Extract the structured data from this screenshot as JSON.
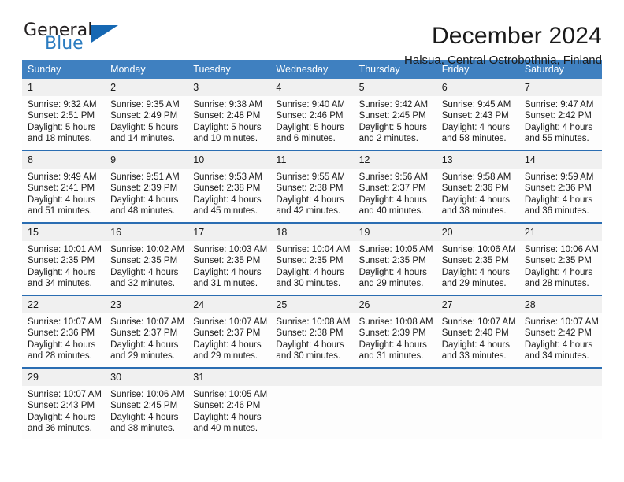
{
  "brand": {
    "name_part1": "General",
    "name_part2": "Blue",
    "triangle_color": "#1668b3",
    "blue_color": "#2b7cc0"
  },
  "header": {
    "title": "December 2024",
    "location": "Halsua, Central Ostrobothnia, Finland"
  },
  "theme": {
    "header_bg": "#3f80c0",
    "row_divider": "#2a6db2",
    "daynum_bg": "#f0f0f0",
    "cell_bg": "#fdfdfd",
    "text": "#1a1a1a"
  },
  "calendar": {
    "weekday_headers": [
      "Sunday",
      "Monday",
      "Tuesday",
      "Wednesday",
      "Thursday",
      "Friday",
      "Saturday"
    ],
    "labels": {
      "sunrise": "Sunrise:",
      "sunset": "Sunset:",
      "daylight": "Daylight:"
    },
    "weeks": [
      [
        {
          "day": "1",
          "sunrise": "Sunrise: 9:32 AM",
          "sunset": "Sunset: 2:51 PM",
          "daylight1": "Daylight: 5 hours",
          "daylight2": "and 18 minutes."
        },
        {
          "day": "2",
          "sunrise": "Sunrise: 9:35 AM",
          "sunset": "Sunset: 2:49 PM",
          "daylight1": "Daylight: 5 hours",
          "daylight2": "and 14 minutes."
        },
        {
          "day": "3",
          "sunrise": "Sunrise: 9:38 AM",
          "sunset": "Sunset: 2:48 PM",
          "daylight1": "Daylight: 5 hours",
          "daylight2": "and 10 minutes."
        },
        {
          "day": "4",
          "sunrise": "Sunrise: 9:40 AM",
          "sunset": "Sunset: 2:46 PM",
          "daylight1": "Daylight: 5 hours",
          "daylight2": "and 6 minutes."
        },
        {
          "day": "5",
          "sunrise": "Sunrise: 9:42 AM",
          "sunset": "Sunset: 2:45 PM",
          "daylight1": "Daylight: 5 hours",
          "daylight2": "and 2 minutes."
        },
        {
          "day": "6",
          "sunrise": "Sunrise: 9:45 AM",
          "sunset": "Sunset: 2:43 PM",
          "daylight1": "Daylight: 4 hours",
          "daylight2": "and 58 minutes."
        },
        {
          "day": "7",
          "sunrise": "Sunrise: 9:47 AM",
          "sunset": "Sunset: 2:42 PM",
          "daylight1": "Daylight: 4 hours",
          "daylight2": "and 55 minutes."
        }
      ],
      [
        {
          "day": "8",
          "sunrise": "Sunrise: 9:49 AM",
          "sunset": "Sunset: 2:41 PM",
          "daylight1": "Daylight: 4 hours",
          "daylight2": "and 51 minutes."
        },
        {
          "day": "9",
          "sunrise": "Sunrise: 9:51 AM",
          "sunset": "Sunset: 2:39 PM",
          "daylight1": "Daylight: 4 hours",
          "daylight2": "and 48 minutes."
        },
        {
          "day": "10",
          "sunrise": "Sunrise: 9:53 AM",
          "sunset": "Sunset: 2:38 PM",
          "daylight1": "Daylight: 4 hours",
          "daylight2": "and 45 minutes."
        },
        {
          "day": "11",
          "sunrise": "Sunrise: 9:55 AM",
          "sunset": "Sunset: 2:38 PM",
          "daylight1": "Daylight: 4 hours",
          "daylight2": "and 42 minutes."
        },
        {
          "day": "12",
          "sunrise": "Sunrise: 9:56 AM",
          "sunset": "Sunset: 2:37 PM",
          "daylight1": "Daylight: 4 hours",
          "daylight2": "and 40 minutes."
        },
        {
          "day": "13",
          "sunrise": "Sunrise: 9:58 AM",
          "sunset": "Sunset: 2:36 PM",
          "daylight1": "Daylight: 4 hours",
          "daylight2": "and 38 minutes."
        },
        {
          "day": "14",
          "sunrise": "Sunrise: 9:59 AM",
          "sunset": "Sunset: 2:36 PM",
          "daylight1": "Daylight: 4 hours",
          "daylight2": "and 36 minutes."
        }
      ],
      [
        {
          "day": "15",
          "sunrise": "Sunrise: 10:01 AM",
          "sunset": "Sunset: 2:35 PM",
          "daylight1": "Daylight: 4 hours",
          "daylight2": "and 34 minutes."
        },
        {
          "day": "16",
          "sunrise": "Sunrise: 10:02 AM",
          "sunset": "Sunset: 2:35 PM",
          "daylight1": "Daylight: 4 hours",
          "daylight2": "and 32 minutes."
        },
        {
          "day": "17",
          "sunrise": "Sunrise: 10:03 AM",
          "sunset": "Sunset: 2:35 PM",
          "daylight1": "Daylight: 4 hours",
          "daylight2": "and 31 minutes."
        },
        {
          "day": "18",
          "sunrise": "Sunrise: 10:04 AM",
          "sunset": "Sunset: 2:35 PM",
          "daylight1": "Daylight: 4 hours",
          "daylight2": "and 30 minutes."
        },
        {
          "day": "19",
          "sunrise": "Sunrise: 10:05 AM",
          "sunset": "Sunset: 2:35 PM",
          "daylight1": "Daylight: 4 hours",
          "daylight2": "and 29 minutes."
        },
        {
          "day": "20",
          "sunrise": "Sunrise: 10:06 AM",
          "sunset": "Sunset: 2:35 PM",
          "daylight1": "Daylight: 4 hours",
          "daylight2": "and 29 minutes."
        },
        {
          "day": "21",
          "sunrise": "Sunrise: 10:06 AM",
          "sunset": "Sunset: 2:35 PM",
          "daylight1": "Daylight: 4 hours",
          "daylight2": "and 28 minutes."
        }
      ],
      [
        {
          "day": "22",
          "sunrise": "Sunrise: 10:07 AM",
          "sunset": "Sunset: 2:36 PM",
          "daylight1": "Daylight: 4 hours",
          "daylight2": "and 28 minutes."
        },
        {
          "day": "23",
          "sunrise": "Sunrise: 10:07 AM",
          "sunset": "Sunset: 2:37 PM",
          "daylight1": "Daylight: 4 hours",
          "daylight2": "and 29 minutes."
        },
        {
          "day": "24",
          "sunrise": "Sunrise: 10:07 AM",
          "sunset": "Sunset: 2:37 PM",
          "daylight1": "Daylight: 4 hours",
          "daylight2": "and 29 minutes."
        },
        {
          "day": "25",
          "sunrise": "Sunrise: 10:08 AM",
          "sunset": "Sunset: 2:38 PM",
          "daylight1": "Daylight: 4 hours",
          "daylight2": "and 30 minutes."
        },
        {
          "day": "26",
          "sunrise": "Sunrise: 10:08 AM",
          "sunset": "Sunset: 2:39 PM",
          "daylight1": "Daylight: 4 hours",
          "daylight2": "and 31 minutes."
        },
        {
          "day": "27",
          "sunrise": "Sunrise: 10:07 AM",
          "sunset": "Sunset: 2:40 PM",
          "daylight1": "Daylight: 4 hours",
          "daylight2": "and 33 minutes."
        },
        {
          "day": "28",
          "sunrise": "Sunrise: 10:07 AM",
          "sunset": "Sunset: 2:42 PM",
          "daylight1": "Daylight: 4 hours",
          "daylight2": "and 34 minutes."
        }
      ],
      [
        {
          "day": "29",
          "sunrise": "Sunrise: 10:07 AM",
          "sunset": "Sunset: 2:43 PM",
          "daylight1": "Daylight: 4 hours",
          "daylight2": "and 36 minutes."
        },
        {
          "day": "30",
          "sunrise": "Sunrise: 10:06 AM",
          "sunset": "Sunset: 2:45 PM",
          "daylight1": "Daylight: 4 hours",
          "daylight2": "and 38 minutes."
        },
        {
          "day": "31",
          "sunrise": "Sunrise: 10:05 AM",
          "sunset": "Sunset: 2:46 PM",
          "daylight1": "Daylight: 4 hours",
          "daylight2": "and 40 minutes."
        },
        {
          "day": "",
          "sunrise": "",
          "sunset": "",
          "daylight1": "",
          "daylight2": ""
        },
        {
          "day": "",
          "sunrise": "",
          "sunset": "",
          "daylight1": "",
          "daylight2": ""
        },
        {
          "day": "",
          "sunrise": "",
          "sunset": "",
          "daylight1": "",
          "daylight2": ""
        },
        {
          "day": "",
          "sunrise": "",
          "sunset": "",
          "daylight1": "",
          "daylight2": ""
        }
      ]
    ]
  }
}
